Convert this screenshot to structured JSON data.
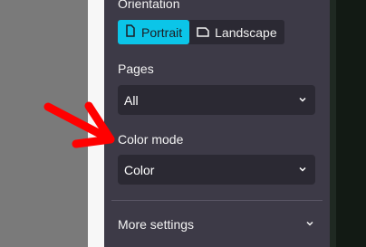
{
  "panel": {
    "orientation_label": "Orientation",
    "orientation_options": [
      {
        "label": "Portrait",
        "selected": true
      },
      {
        "label": "Landscape",
        "selected": false
      }
    ],
    "pages_label": "Pages",
    "pages_value": "All",
    "color_mode_label": "Color mode",
    "color_mode_value": "Color",
    "more_settings_label": "More settings"
  },
  "colors": {
    "accent": "#0bc5e8",
    "panel_bg": "#3d3a47",
    "control_bg": "#2b2933",
    "annotation_arrow": "#ff0000"
  }
}
